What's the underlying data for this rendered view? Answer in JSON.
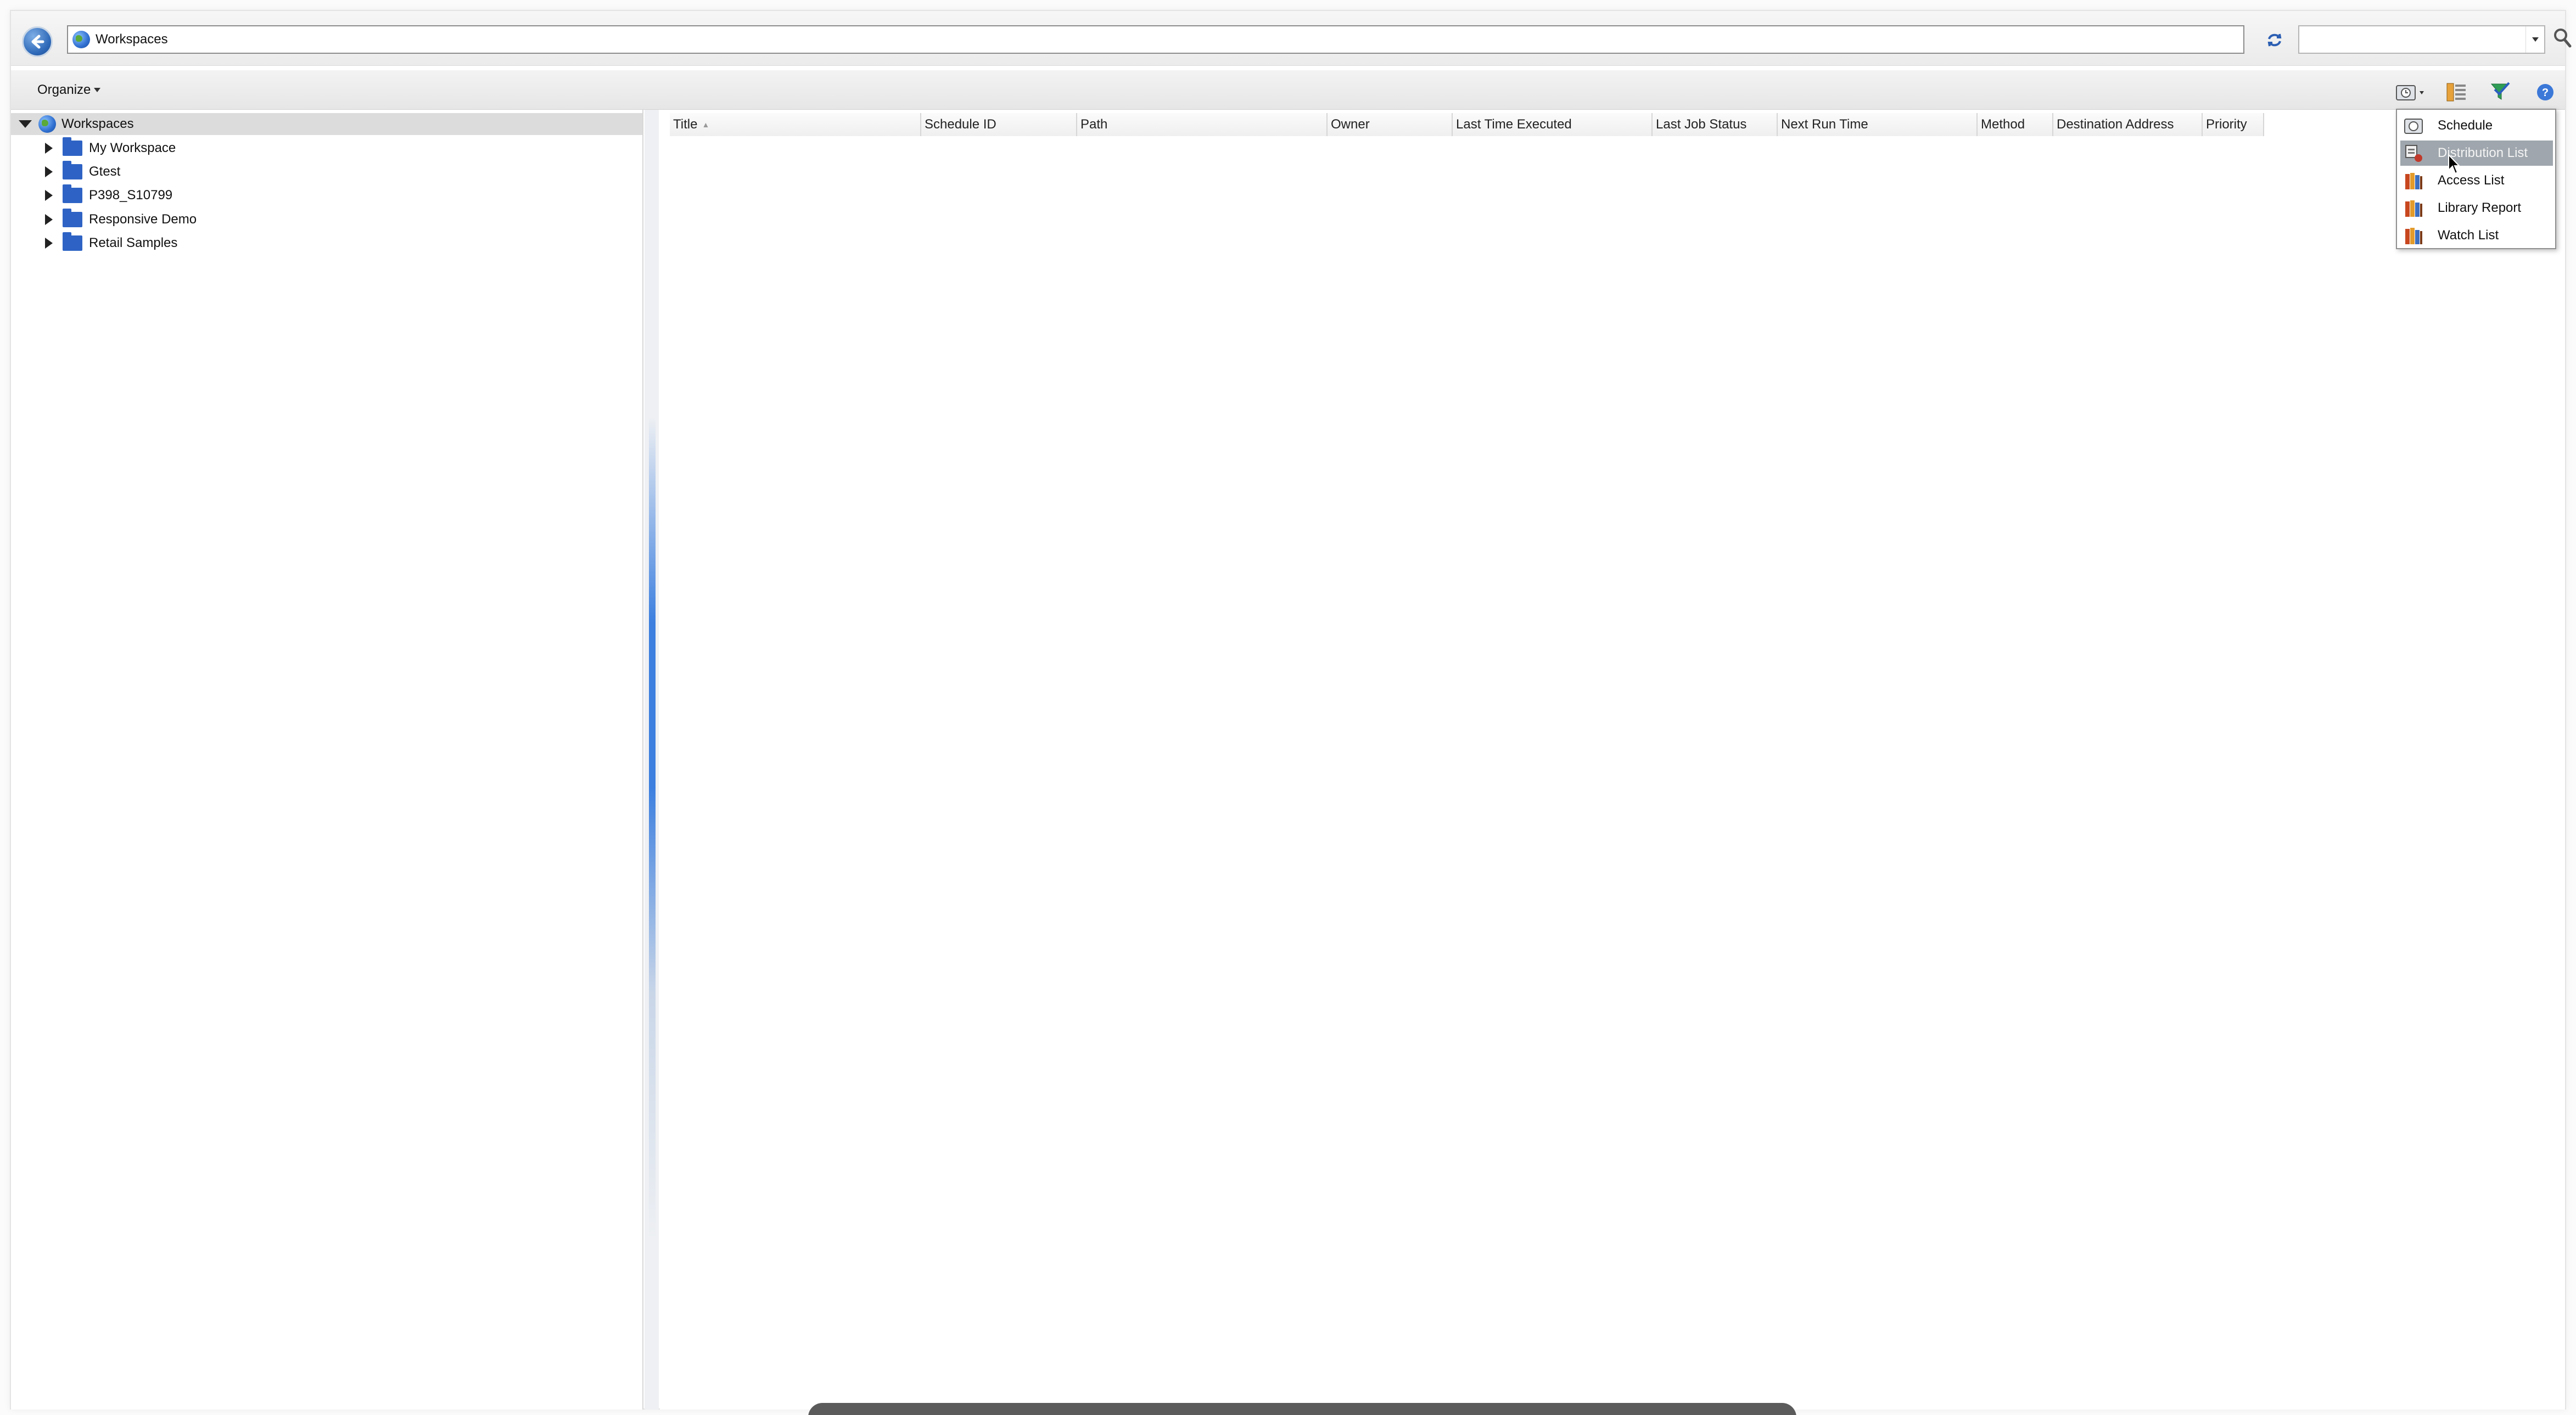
{
  "address_bar": {
    "path": "Workspaces",
    "search_value": ""
  },
  "toolbar": {
    "organize_label": "Organize"
  },
  "tree": {
    "root": "Workspaces",
    "children": [
      "My Workspace",
      "Gtest",
      "P398_S10799",
      "Responsive Demo",
      "Retail Samples"
    ]
  },
  "grid": {
    "columns": [
      "Title",
      "Schedule ID",
      "Path",
      "Owner",
      "Last Time Executed",
      "Last Job Status",
      "Next Run Time",
      "Method",
      "Destination Address",
      "Priority"
    ],
    "sort_column": "Title",
    "rows": []
  },
  "new_menu": {
    "items": [
      "Schedule",
      "Distribution List",
      "Access List",
      "Library Report",
      "Watch List"
    ],
    "highlighted": "Distribution List"
  },
  "colors": {
    "selection": "#dcdcdc",
    "folder": "#2e63c5",
    "accent": "#3c7fdf",
    "menu_highlight": "#9fa6ad"
  }
}
